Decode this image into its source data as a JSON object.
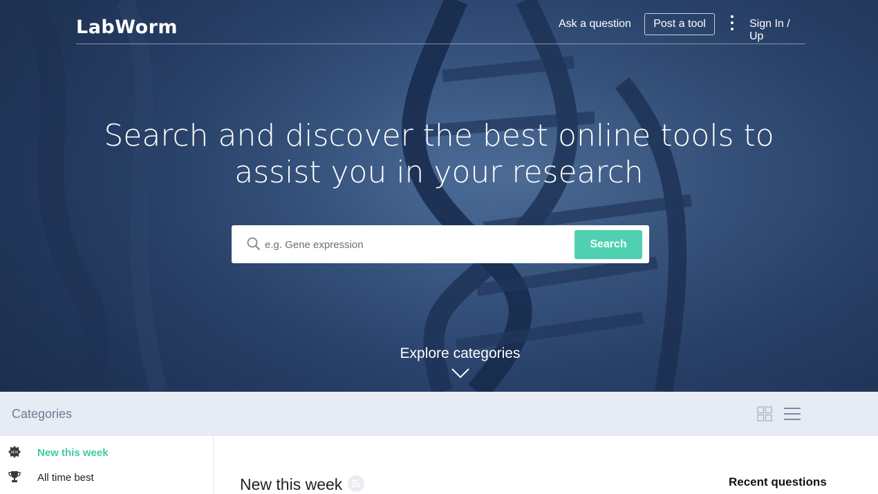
{
  "brand": {
    "logo_text": "LabWorm"
  },
  "nav": {
    "ask_label": "Ask a question",
    "post_label": "Post a tool",
    "menu_icon": "kebab-menu-icon",
    "sign_label": "Sign In / Up"
  },
  "hero": {
    "headline_line1": "Search and discover the best online tools to",
    "headline_line2": "assist you in your research",
    "search_placeholder": "e.g. Gene expression",
    "search_icon": "search-icon",
    "search_button": "Search",
    "explore_label": "Explore categories",
    "explore_icon": "chevron-down-icon"
  },
  "categories_bar": {
    "title": "Categories",
    "view_icons": [
      "grid-view-icon",
      "list-view-icon"
    ]
  },
  "sidebar": {
    "items": [
      {
        "label": "New this week",
        "icon": "new-badge-icon",
        "active": true
      },
      {
        "label": "All time best",
        "icon": "trophy-icon",
        "active": false
      }
    ]
  },
  "main": {
    "section_title": "New this week",
    "rss_icon": "rss-icon"
  },
  "aside": {
    "title": "Recent questions"
  },
  "colors": {
    "accent": "#4fd1b1",
    "active_text": "#3fc9a6",
    "hero_blue": "#2c4670",
    "category_bar_bg": "#e7ebf3"
  }
}
